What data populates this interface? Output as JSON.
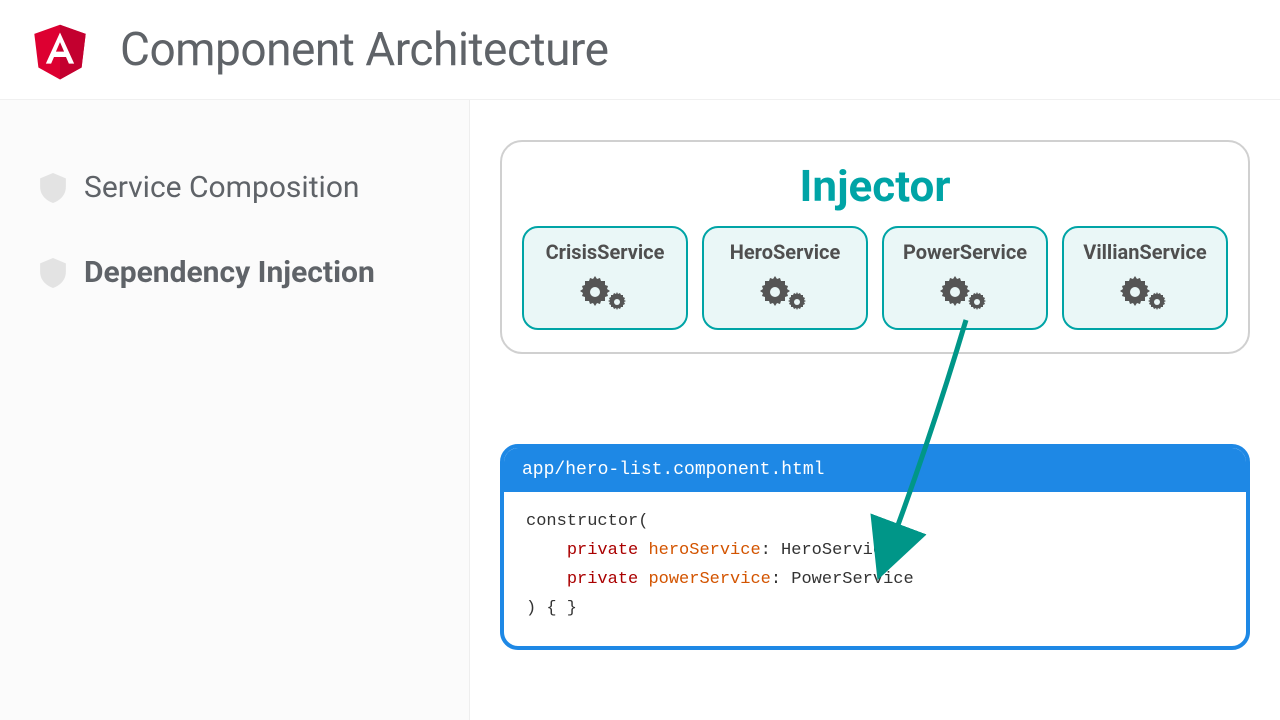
{
  "header": {
    "title": "Component Architecture"
  },
  "sidebar": {
    "items": [
      {
        "label": "Service Composition",
        "active": false
      },
      {
        "label": "Dependency Injection",
        "active": true
      }
    ]
  },
  "injector": {
    "title": "Injector",
    "services": [
      "CrisisService",
      "HeroService",
      "PowerService",
      "VillianService"
    ]
  },
  "code": {
    "filename": "app/hero-list.component.html",
    "lines": {
      "l0": "constructor(",
      "l1_kw": "private",
      "l1_id": "heroService",
      "l1_rest": ": HeroService,",
      "l2_kw": "private",
      "l2_id": "powerService",
      "l2_rest": ": PowerService",
      "l3": ") { }"
    }
  },
  "colors": {
    "teal": "#00a4a6",
    "blue": "#1e88e5",
    "angularRed": "#dd0031"
  }
}
